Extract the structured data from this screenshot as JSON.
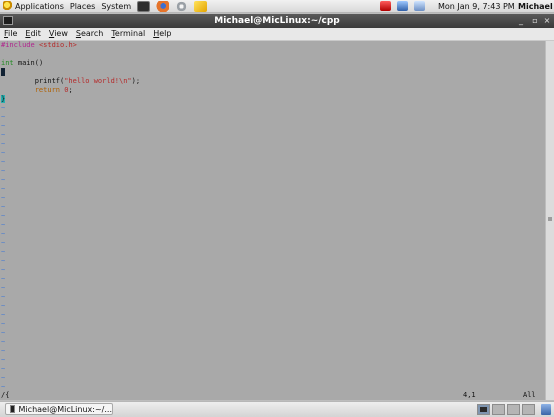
{
  "top_panel": {
    "menus": [
      "Applications",
      "Places",
      "System"
    ],
    "launchers": [
      "terminal-icon",
      "firefox-icon",
      "settings-icon",
      "notes-icon"
    ],
    "tray_icons": [
      "volume-muted-icon",
      "network-icon",
      "monitor-icon"
    ],
    "clock": "Mon Jan  9,  7:43 PM",
    "user": "Michael"
  },
  "window": {
    "title": "Michael@MicLinux:~/cpp",
    "controls": {
      "minimize": "_",
      "maximize": "▫",
      "close": "×"
    }
  },
  "menubar": [
    {
      "label": "File",
      "mnemonic": "F",
      "rest": "ile"
    },
    {
      "label": "Edit",
      "mnemonic": "E",
      "rest": "dit"
    },
    {
      "label": "View",
      "mnemonic": "V",
      "rest": "iew"
    },
    {
      "label": "Search",
      "mnemonic": "S",
      "rest": "earch"
    },
    {
      "label": "Terminal",
      "mnemonic": "T",
      "rest": "erminal"
    },
    {
      "label": "Help",
      "mnemonic": "H",
      "rest": "elp"
    }
  ],
  "editor": {
    "include_directive": "#include",
    "include_file": "<stdio.h>",
    "main_type": "int",
    "main_rest": " main()",
    "open_brace": "{",
    "printf_prefix": "        printf(",
    "printf_string": "\"hello world!\\n\"",
    "printf_suffix": ");",
    "return_kw": "        return ",
    "return_val": "0",
    "return_end": ";",
    "close_brace": "}",
    "tilde": "~",
    "command_line": "/{",
    "cursor_position": "4,1",
    "scroll_position": "All"
  },
  "bottom_panel": {
    "task_label": "Michael@MicLinux:~/..."
  }
}
